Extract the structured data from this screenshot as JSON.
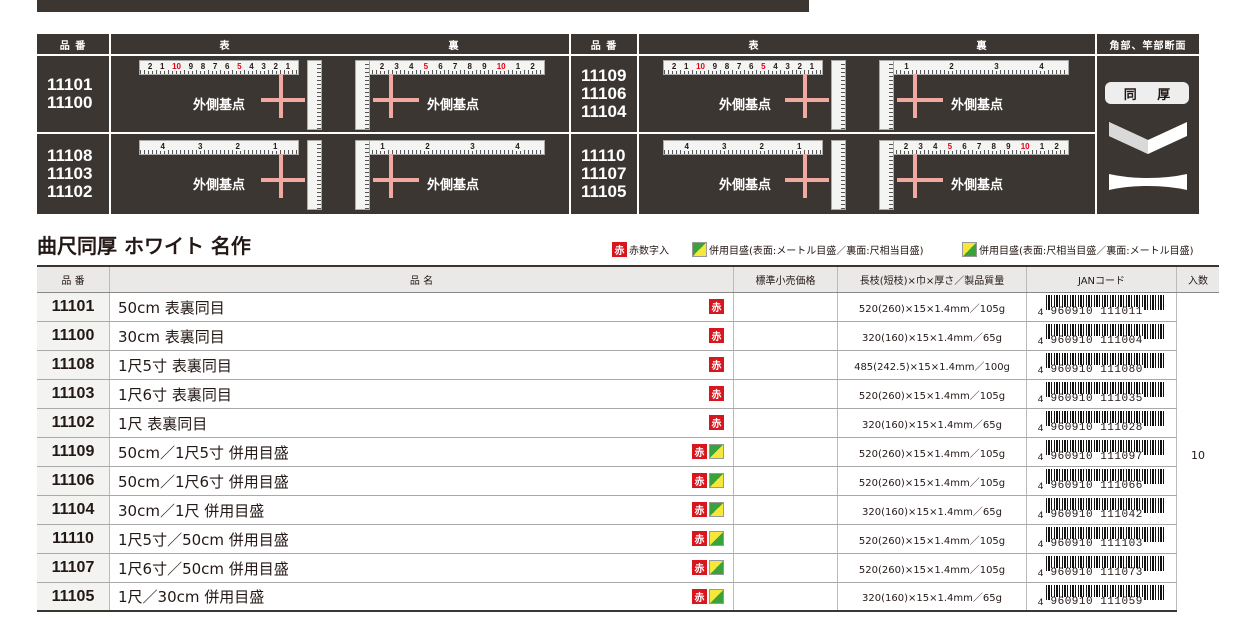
{
  "header_columns": {
    "code": "品 番",
    "front": "表",
    "back": "裏",
    "code2": "品 番",
    "front2": "表",
    "back2": "裏",
    "section": "角部、竿部断面"
  },
  "groups": [
    {
      "codes": [
        "11101",
        "11100"
      ]
    },
    {
      "codes": [
        "11108",
        "11103",
        "11102"
      ]
    },
    {
      "codes": [
        "11109",
        "11106",
        "11104"
      ]
    },
    {
      "codes": [
        "11110",
        "11107",
        "11105"
      ]
    }
  ],
  "ruler_labels": {
    "outer_base": "外側基点"
  },
  "dohatsu_label": "同 厚",
  "section_title": "曲尺同厚 ホワイト 名作",
  "legend": {
    "red_text": "赤",
    "red_label": "赤数字入",
    "cm_label": "併用目盛(表面:メートル目盛／裏面:尺相当目盛)",
    "shaku_label": "併用目盛(表面:尺相当目盛／裏面:メートル目盛)"
  },
  "table": {
    "headers": {
      "code": "品 番",
      "name": "品 名",
      "price": "標準小売価格",
      "spec": "長枝(短枝)×巾×厚さ／製品質量",
      "jan": "JANコード",
      "qty": "入数"
    },
    "qty_value": "10",
    "rows": [
      {
        "code": "11101",
        "name": "50cm 表裏同目",
        "spec": "520(260)×15×1.4mm／105g",
        "jan_lead": "4",
        "jan": "960910 111011",
        "badge": "red"
      },
      {
        "code": "11100",
        "name": "30cm 表裏同目",
        "spec": "320(160)×15×1.4mm／65g",
        "jan_lead": "4",
        "jan": "960910 111004",
        "badge": "red"
      },
      {
        "code": "11108",
        "name": "1尺5寸 表裏同目",
        "spec": "485(242.5)×15×1.4mm／100g",
        "jan_lead": "4",
        "jan": "960910 111080",
        "badge": "red"
      },
      {
        "code": "11103",
        "name": "1尺6寸 表裏同目",
        "spec": "520(260)×15×1.4mm／105g",
        "jan_lead": "4",
        "jan": "960910 111035",
        "badge": "red"
      },
      {
        "code": "11102",
        "name": "1尺 表裏同目",
        "spec": "320(160)×15×1.4mm／65g",
        "jan_lead": "4",
        "jan": "960910 111028",
        "badge": "red"
      },
      {
        "code": "11109",
        "name": "50cm／1尺5寸 併用目盛",
        "spec": "520(260)×15×1.4mm／105g",
        "jan_lead": "4",
        "jan": "960910 111097",
        "badge": "red-cm"
      },
      {
        "code": "11106",
        "name": "50cm／1尺6寸 併用目盛",
        "spec": "520(260)×15×1.4mm／105g",
        "jan_lead": "4",
        "jan": "960910 111066",
        "badge": "red-cm"
      },
      {
        "code": "11104",
        "name": "30cm／1尺 併用目盛",
        "spec": "320(160)×15×1.4mm／65g",
        "jan_lead": "4",
        "jan": "960910 111042",
        "badge": "red-cm"
      },
      {
        "code": "11110",
        "name": "1尺5寸／50cm 併用目盛",
        "spec": "520(260)×15×1.4mm／105g",
        "jan_lead": "4",
        "jan": "960910 111103",
        "badge": "red-shaku"
      },
      {
        "code": "11107",
        "name": "1尺6寸／50cm 併用目盛",
        "spec": "520(260)×15×1.4mm／105g",
        "jan_lead": "4",
        "jan": "960910 111073",
        "badge": "red-shaku"
      },
      {
        "code": "11105",
        "name": "1尺／30cm 併用目盛",
        "spec": "320(160)×15×1.4mm／65g",
        "jan_lead": "4",
        "jan": "960910 111059",
        "badge": "red-shaku"
      }
    ]
  },
  "colors": {
    "dark": "#3b3632",
    "red": "#d8161e",
    "arrow": "#f0a8a0"
  }
}
